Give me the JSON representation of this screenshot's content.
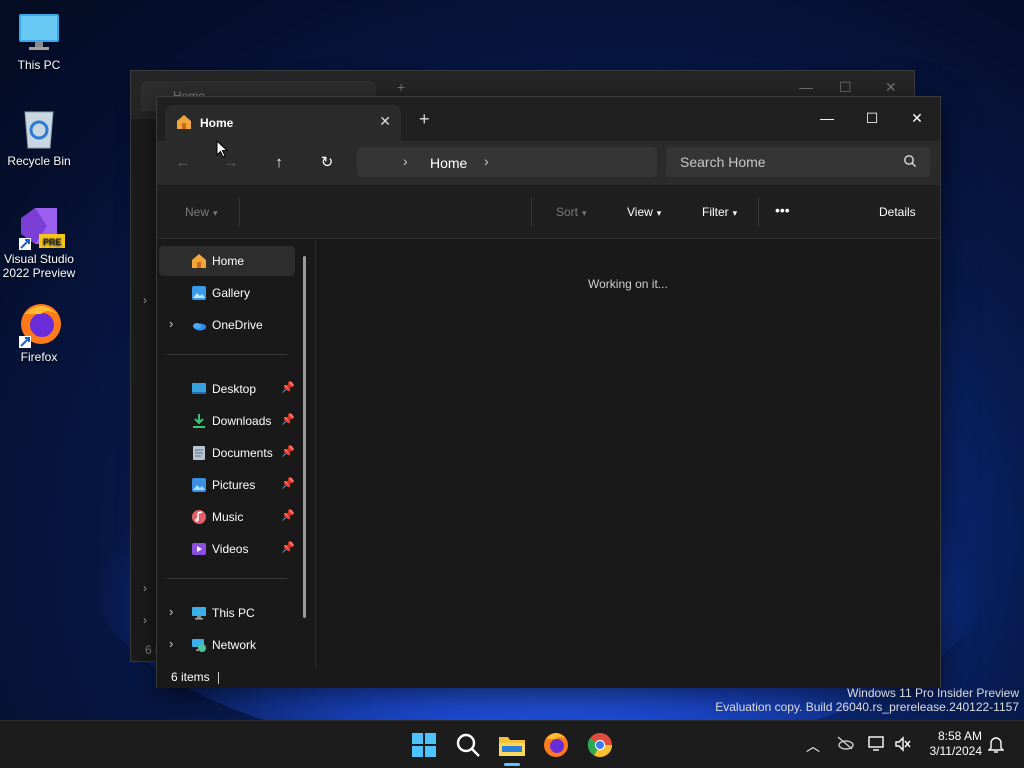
{
  "desktop": {
    "icons": [
      {
        "label": "This PC"
      },
      {
        "label": "Recycle Bin"
      },
      {
        "label": "Visual Studio 2022 Preview",
        "badge": "PRE"
      },
      {
        "label": "Firefox"
      }
    ]
  },
  "back_window": {
    "tab_label": "Home",
    "status_text": "6 i"
  },
  "window": {
    "tab_label": "Home",
    "breadcrumb": "Home",
    "search_placeholder": "Search Home",
    "toolbar": {
      "new_label": "New",
      "sort_label": "Sort",
      "view_label": "View",
      "filter_label": "Filter",
      "more_label": "•••",
      "details_label": "Details"
    },
    "sidebar": {
      "top_items": [
        {
          "label": "Home",
          "icon": "home-icon",
          "active": true
        },
        {
          "label": "Gallery",
          "icon": "gallery-icon"
        },
        {
          "label": "OneDrive",
          "icon": "onedrive-icon",
          "expandable": true
        }
      ],
      "pinned": [
        {
          "label": "Desktop",
          "icon": "desktop-icon"
        },
        {
          "label": "Downloads",
          "icon": "downloads-icon"
        },
        {
          "label": "Documents",
          "icon": "documents-icon"
        },
        {
          "label": "Pictures",
          "icon": "pictures-icon"
        },
        {
          "label": "Music",
          "icon": "music-icon"
        },
        {
          "label": "Videos",
          "icon": "videos-icon"
        }
      ],
      "bottom_items": [
        {
          "label": "This PC",
          "icon": "this-pc-icon"
        },
        {
          "label": "Network",
          "icon": "network-icon"
        }
      ]
    },
    "content_status": "Working on it...",
    "item_count": "6 items"
  },
  "watermark": {
    "line1": "Windows 11 Pro Insider Preview",
    "line2": "Evaluation copy. Build 26040.rs_prerelease.240122-1157"
  },
  "taskbar": {
    "time": "8:58 AM",
    "date": "3/11/2024",
    "apps": [
      "start-icon",
      "search-icon",
      "file-explorer-icon",
      "firefox-icon",
      "chrome-icon"
    ]
  },
  "colors": {
    "accent": "#62c3ff",
    "window_bg": "#191919",
    "navbar_bg": "#2b2b2b"
  }
}
